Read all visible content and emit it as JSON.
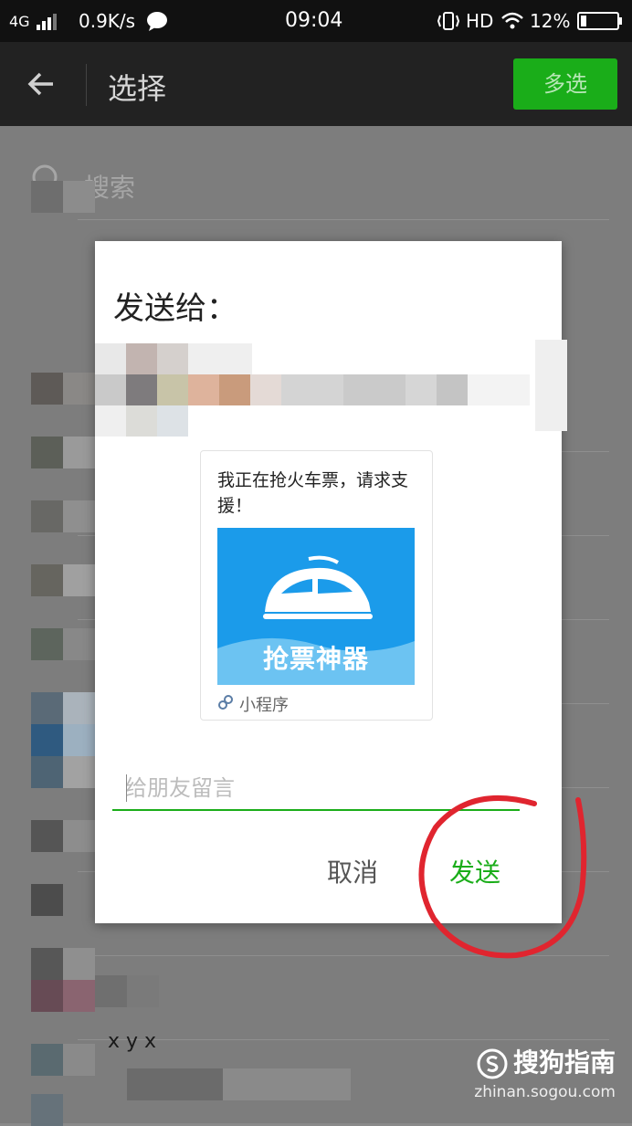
{
  "status_bar": {
    "network": "4G",
    "speed": "0.9K/s",
    "time": "09:04",
    "hd": "HD",
    "battery": "12%"
  },
  "app_bar": {
    "title": "选择",
    "multi_select": "多选"
  },
  "search": {
    "placeholder": "搜索"
  },
  "dialog": {
    "title": "发送给：",
    "card": {
      "text": "我正在抢火车票，请求支援！",
      "image_text": "抢票神器",
      "mini_program_label": "小程序"
    },
    "input_placeholder": "给朋友留言",
    "cancel": "取消",
    "send": "发送"
  },
  "background_fragment": "x y x",
  "watermark": {
    "brand": "搜狗指南",
    "url": "zhinan.sogou.com"
  },
  "colors": {
    "accent_green": "#1aad19",
    "annotation_red": "#e0252f",
    "card_blue": "#1b9bea"
  }
}
